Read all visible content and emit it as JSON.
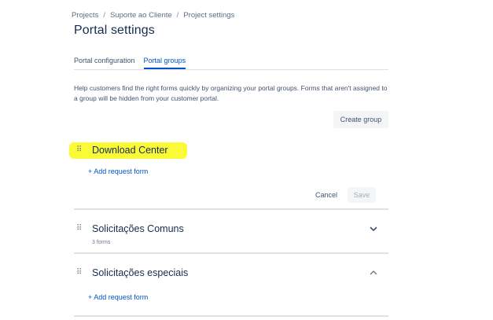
{
  "breadcrumb": [
    "Projects",
    "Suporte ao Cliente",
    "Project settings"
  ],
  "breadcrumb_separator": "/",
  "page_title": "Portal settings",
  "tabs": [
    {
      "label": "Portal configuration",
      "active": false
    },
    {
      "label": "Portal groups",
      "active": true
    }
  ],
  "help_text": "Help customers find the right forms quickly by organizing your portal groups. Forms that aren't assigned to a group will be hidden from your customer portal.",
  "create_group_label": "Create group",
  "groups": [
    {
      "name": "Download Center",
      "add_form_label": "+ Add request form",
      "cancel_label": "Cancel",
      "save_label": "Save",
      "state": "editing",
      "highlighted": true
    },
    {
      "name": "Solicitações Comuns",
      "forms_count": "3 forms",
      "state": "collapsed",
      "chevron": "chevron-down-icon"
    },
    {
      "name": "Solicitações especiais",
      "add_form_label": "+ Add request form",
      "state": "expanded",
      "chevron": "chevron-up-icon"
    }
  ],
  "colors": {
    "accent": "#0052cc",
    "highlight": "#fafa37",
    "text": "#172b4d",
    "muted": "#42526e"
  }
}
